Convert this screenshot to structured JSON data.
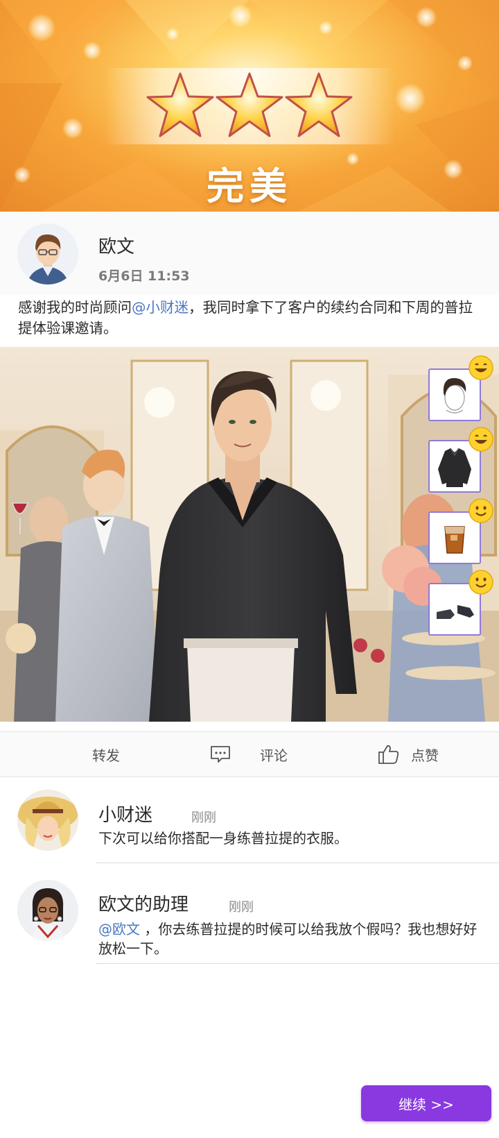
{
  "result": {
    "stars_earned": 3,
    "stars_total": 3,
    "title": "完美"
  },
  "post": {
    "author": "欧文",
    "time": "6月6日 11:53",
    "text_before": "感谢我的时尚顾问",
    "mention": "@小财迷",
    "text_after": "，我同时拿下了客户的续约合同和下周的普拉提体验课邀请。",
    "outfit_items": [
      {
        "icon": "hairstyle-icon",
        "reaction": "grin-emoji"
      },
      {
        "icon": "black-shirt-icon",
        "reaction": "grin-emoji"
      },
      {
        "icon": "whiskey-glass-icon",
        "reaction": "smile-emoji"
      },
      {
        "icon": "leather-shoes-icon",
        "reaction": "smile-emoji"
      }
    ]
  },
  "actions": {
    "share": "转发",
    "comment": "评论",
    "like": "点赞"
  },
  "comments": [
    {
      "name": "小财迷",
      "time": "刚刚",
      "mention": "",
      "text": "下次可以给你搭配一身练普拉提的衣服。"
    },
    {
      "name": "欧文的助理",
      "time": "刚刚",
      "mention": "@欧文",
      "text": "，你去练普拉提的时候可以给我放个假吗？我也想好好放松一下。"
    }
  ],
  "continue_button": "继续 >>",
  "colors": {
    "accent": "#8a39e1",
    "mention": "#4a78c2",
    "banner": "#f7a63a"
  }
}
